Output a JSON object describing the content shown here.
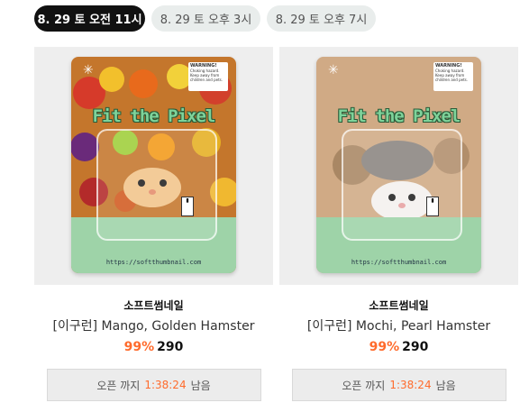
{
  "tabs": [
    {
      "label": "8. 29 토 오전 11시",
      "active": true
    },
    {
      "label": "8. 29 토 오후 3시",
      "active": false
    },
    {
      "label": "8. 29 토 오후 7시",
      "active": false
    }
  ],
  "products": [
    {
      "seller": "소프트썸네일",
      "name": "[이구런] Mango, Golden Hamster",
      "discount": "99%",
      "price": "290",
      "countdown_prefix": "오픈 까지",
      "countdown_time": "1:38:24",
      "countdown_suffix": "남음",
      "package": {
        "brand": "Fit the Pixel",
        "url": "https://softthumbnail.com",
        "warning_title": "WARNING!",
        "warning_text": "Choking hazard. Keep away from children and pets."
      }
    },
    {
      "seller": "소프트썸네일",
      "name": "[이구런] Mochi, Pearl Hamster",
      "discount": "99%",
      "price": "290",
      "countdown_prefix": "오픈 까지",
      "countdown_time": "1:38:24",
      "countdown_suffix": "남음",
      "package": {
        "brand": "Fit the Pixel",
        "url": "https://softthumbnail.com",
        "warning_title": "WARNING!",
        "warning_text": "Choking hazard. Keep away from children and pets."
      }
    }
  ],
  "colors": {
    "accent": "#ff6b2c",
    "active_tab": "#111111",
    "tab_bg": "#e9edec",
    "package_green": "#9ed3a8"
  }
}
